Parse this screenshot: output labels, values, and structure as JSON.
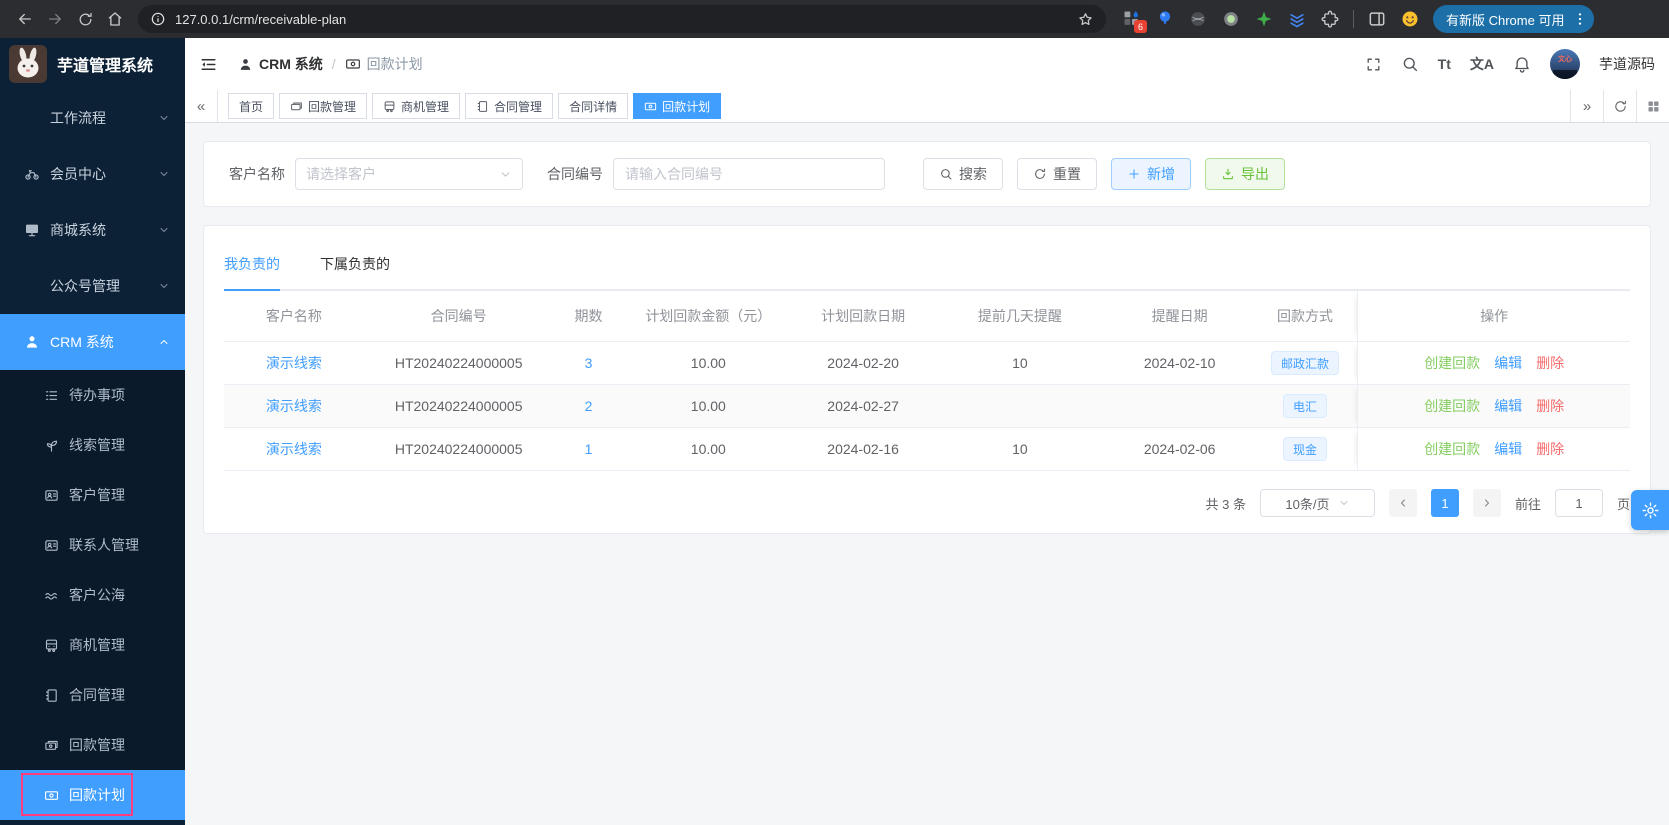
{
  "browser": {
    "url": "127.0.0.1/crm/receivable-plan",
    "extension_badge": "6",
    "update_button": "有新版 Chrome 可用"
  },
  "app": {
    "title": "芋道管理系统",
    "user_name": "芋道源码",
    "avatar_text": "文心"
  },
  "breadcrumb": {
    "section": "CRM 系统",
    "separator": "/",
    "page": "回款计划"
  },
  "sidebar": {
    "items": [
      {
        "label": "工作流程"
      },
      {
        "label": "会员中心"
      },
      {
        "label": "商城系统"
      },
      {
        "label": "公众号管理"
      },
      {
        "label": "CRM 系统"
      }
    ],
    "submenu": [
      {
        "label": "待办事项"
      },
      {
        "label": "线索管理"
      },
      {
        "label": "客户管理"
      },
      {
        "label": "联系人管理"
      },
      {
        "label": "客户公海"
      },
      {
        "label": "商机管理"
      },
      {
        "label": "合同管理"
      },
      {
        "label": "回款管理"
      },
      {
        "label": "回款计划"
      }
    ]
  },
  "tabbar": {
    "tabs": [
      {
        "label": "首页"
      },
      {
        "label": "回款管理"
      },
      {
        "label": "商机管理"
      },
      {
        "label": "合同管理"
      },
      {
        "label": "合同详情"
      },
      {
        "label": "回款计划"
      }
    ]
  },
  "icons": {
    "font_size": "Tt",
    "translate": "文A",
    "tabs_prev": "«",
    "tabs_next": "»"
  },
  "filter": {
    "customer_label": "客户名称",
    "customer_placeholder": "请选择客户",
    "contract_label": "合同编号",
    "contract_placeholder": "请输入合同编号",
    "search_button": "搜索",
    "reset_button": "重置",
    "add_button": "新增",
    "export_button": "导出"
  },
  "panel_tabs": {
    "mine": "我负责的",
    "subordinate": "下属负责的"
  },
  "table": {
    "headers": [
      "客户名称",
      "合同编号",
      "期数",
      "计划回款金额（元）",
      "计划回款日期",
      "提前几天提醒",
      "提醒日期",
      "回款方式",
      "操作"
    ],
    "actions": {
      "create": "创建回款",
      "edit": "编辑",
      "delete": "删除"
    },
    "rows": [
      {
        "customer": "演示线索",
        "contract_no": "HT20240224000005",
        "period": "3",
        "amount": "10.00",
        "plan_date": "2024-02-20",
        "remind_days": "10",
        "remind_date": "2024-02-10",
        "method": "邮政汇款"
      },
      {
        "customer": "演示线索",
        "contract_no": "HT20240224000005",
        "period": "2",
        "amount": "10.00",
        "plan_date": "2024-02-27",
        "remind_days": "",
        "remind_date": "",
        "method": "电汇"
      },
      {
        "customer": "演示线索",
        "contract_no": "HT20240224000005",
        "period": "1",
        "amount": "10.00",
        "plan_date": "2024-02-16",
        "remind_days": "10",
        "remind_date": "2024-02-06",
        "method": "现金"
      }
    ]
  },
  "pagination": {
    "total": "共 3 条",
    "page_size": "10条/页",
    "current_page": "1",
    "goto_label": "前往",
    "goto_value": "1",
    "unit_label": "页"
  },
  "colors": {
    "primary": "#409eff",
    "success": "#67c23a",
    "danger": "#f56c6c",
    "sidebar_bg": "#0d2136",
    "highlight_border": "#ff3d7f"
  }
}
